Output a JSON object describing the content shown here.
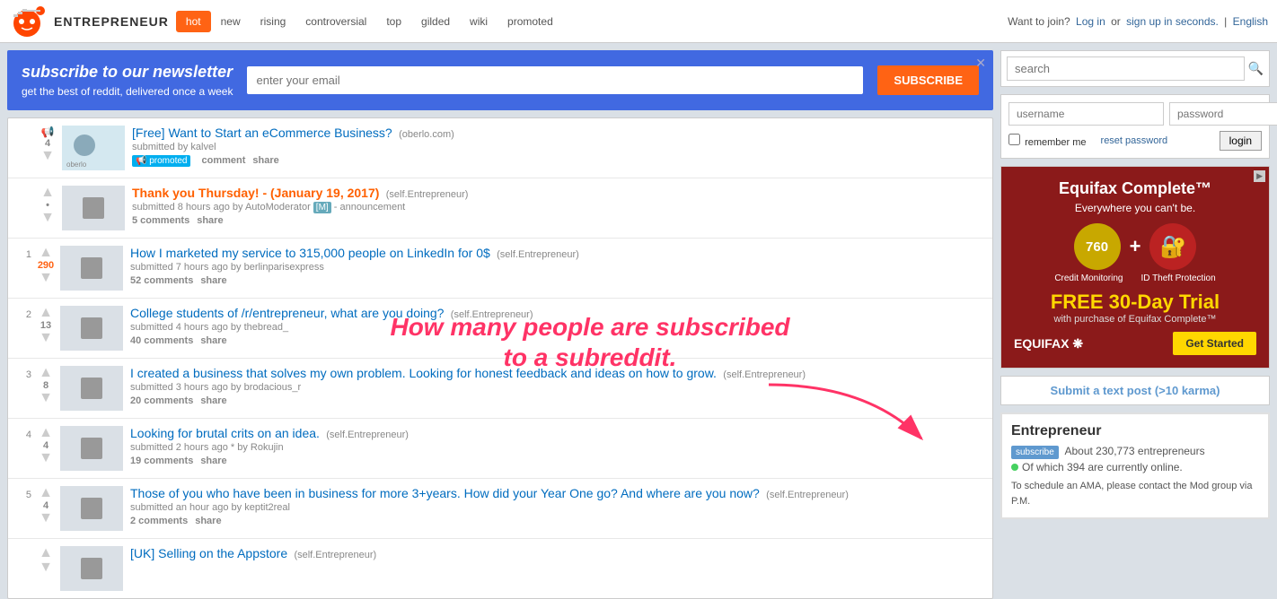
{
  "header": {
    "subreddit": "Entrepreneur",
    "tabs": [
      {
        "label": "hot",
        "active": true
      },
      {
        "label": "new",
        "active": false
      },
      {
        "label": "rising",
        "active": false
      },
      {
        "label": "controversial",
        "active": false
      },
      {
        "label": "top",
        "active": false
      },
      {
        "label": "gilded",
        "active": false
      },
      {
        "label": "wiki",
        "active": false
      },
      {
        "label": "promoted",
        "active": false
      }
    ],
    "join_text": "Want to join?",
    "login_text": "Log in",
    "or_text": "or",
    "signup_text": "sign up in seconds.",
    "language": "English"
  },
  "newsletter": {
    "title_plain": "subscribe to our",
    "title_italic": "newsletter",
    "subtitle": "get the best of reddit, delivered once a week",
    "email_placeholder": "enter your email",
    "subscribe_label": "SUBSCRIBE"
  },
  "posts": [
    {
      "rank": "",
      "score": "4",
      "is_promoted": true,
      "title": "[Free] Want to Start an eCommerce Business?",
      "domain": "oberlo.com",
      "submitted_by": "kalvel",
      "actions": [
        "promoted",
        "comment",
        "share"
      ],
      "has_thumbnail": true
    },
    {
      "rank": "",
      "score": "",
      "is_promoted": false,
      "is_mod": true,
      "title": "Thank you Thursday! - (January 19, 2017)",
      "domain": "self.Entrepreneur",
      "submitted": "submitted 8 hours ago by AutoModerator [M] - announcement",
      "comments": "5 comments",
      "actions": [
        "5 comments",
        "share"
      ]
    },
    {
      "rank": "1",
      "score": "290",
      "is_promoted": false,
      "title": "How I marketed my service to 315,000 people on LinkedIn for 0$",
      "domain": "self.Entrepreneur",
      "submitted": "submitted 7 hours ago by berlinparisexpress",
      "comments": "52 comments",
      "actions": [
        "52 comments",
        "share"
      ]
    },
    {
      "rank": "2",
      "score": "13",
      "is_promoted": false,
      "title": "College students of /r/entrepreneur, what are you doing?",
      "domain": "self.Entrepreneur",
      "submitted": "submitted 4 hours ago by thebread_",
      "comments": "40 comments",
      "actions": [
        "40 comments",
        "share"
      ]
    },
    {
      "rank": "3",
      "score": "8",
      "is_promoted": false,
      "title": "I created a business that solves my own problem. Looking for honest feedback and ideas on how to grow.",
      "domain": "self.Entrepreneur",
      "submitted": "submitted 3 hours ago by brodacious_r",
      "comments": "20 comments",
      "actions": [
        "20 comments",
        "share"
      ]
    },
    {
      "rank": "4",
      "score": "4",
      "is_promoted": false,
      "title": "Looking for brutal crits on an idea.",
      "domain": "self.Entrepreneur",
      "submitted": "submitted 2 hours ago * by Rokujin",
      "comments": "19 comments",
      "actions": [
        "19 comments",
        "share"
      ]
    },
    {
      "rank": "5",
      "score": "4",
      "is_promoted": false,
      "title": "Those of you who have been in business for more 3+years. How did your Year One go? And where are you now?",
      "domain": "self.Entrepreneur",
      "submitted": "submitted an hour ago by keptit2real",
      "comments": "2 comments",
      "actions": [
        "2 comments",
        "share"
      ]
    },
    {
      "rank": "",
      "score": "",
      "is_promoted": false,
      "title": "[UK] Selling on the Appstore",
      "domain": "self.Entrepreneur",
      "submitted": "",
      "comments": "",
      "actions": []
    }
  ],
  "sidebar": {
    "search_placeholder": "search",
    "search_button_label": "🔍",
    "username_placeholder": "username",
    "password_placeholder": "password",
    "remember_me_label": "remember me",
    "reset_password_label": "reset password",
    "login_label": "login",
    "ad": {
      "brand": "Equifax Complete™",
      "tagline": "Everywhere you can't be.",
      "score": "760",
      "label1": "Credit Monitoring",
      "label2": "ID Theft Protection",
      "free_trial": "FREE 30-Day Trial",
      "free_trial_sub": "with purchase of Equifax Complete™",
      "footer_brand": "EQUIFAX ❋",
      "get_started": "Get Started"
    },
    "submit_text": "Submit a text post (>10 karma)",
    "subreddit": {
      "name": "Entrepreneur",
      "subscribe_label": "subscribe",
      "about": "About 230,773 entrepreneurs",
      "online": "Of which 394 are currently online.",
      "description": "To schedule an AMA, please contact the Mod group via P.M."
    }
  },
  "annotation": {
    "line1": "How many people are subscribed",
    "line2": "to a subreddit."
  }
}
